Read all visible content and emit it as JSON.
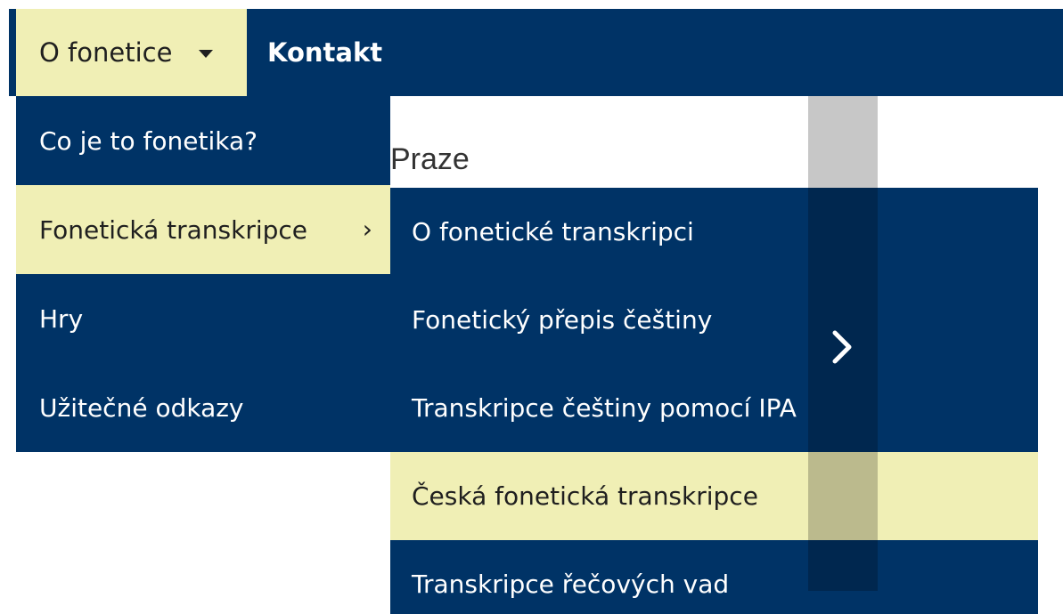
{
  "topnav": {
    "o_fonetice": "O fonetice",
    "kontakt": "Kontakt"
  },
  "page": {
    "heading": "Praze"
  },
  "dropdown1": {
    "items": [
      {
        "label": "Co je to fonetika?"
      },
      {
        "label": "Fonetická transkripce",
        "chevron": "›"
      },
      {
        "label": "Hry"
      },
      {
        "label": "Užitečné odkazy"
      }
    ]
  },
  "dropdown2": {
    "items": [
      {
        "label": "O fonetické transkripci"
      },
      {
        "label": "Fonetický přepis češtiny"
      },
      {
        "label": "Transkripce češtiny pomocí IPA"
      },
      {
        "label": "Česká fonetická transkripce"
      },
      {
        "label": "Transkripce řečových vad"
      }
    ]
  },
  "icons": {
    "caret": "caret-down-icon",
    "submenu_chevron": "chevron-right-icon",
    "scroll_chevron": "chevron-right-icon"
  },
  "colors": {
    "navy": "#003366",
    "highlight": "#f0efb5",
    "text_dark": "#1f1f1f",
    "accent_red": "#c8202a"
  }
}
